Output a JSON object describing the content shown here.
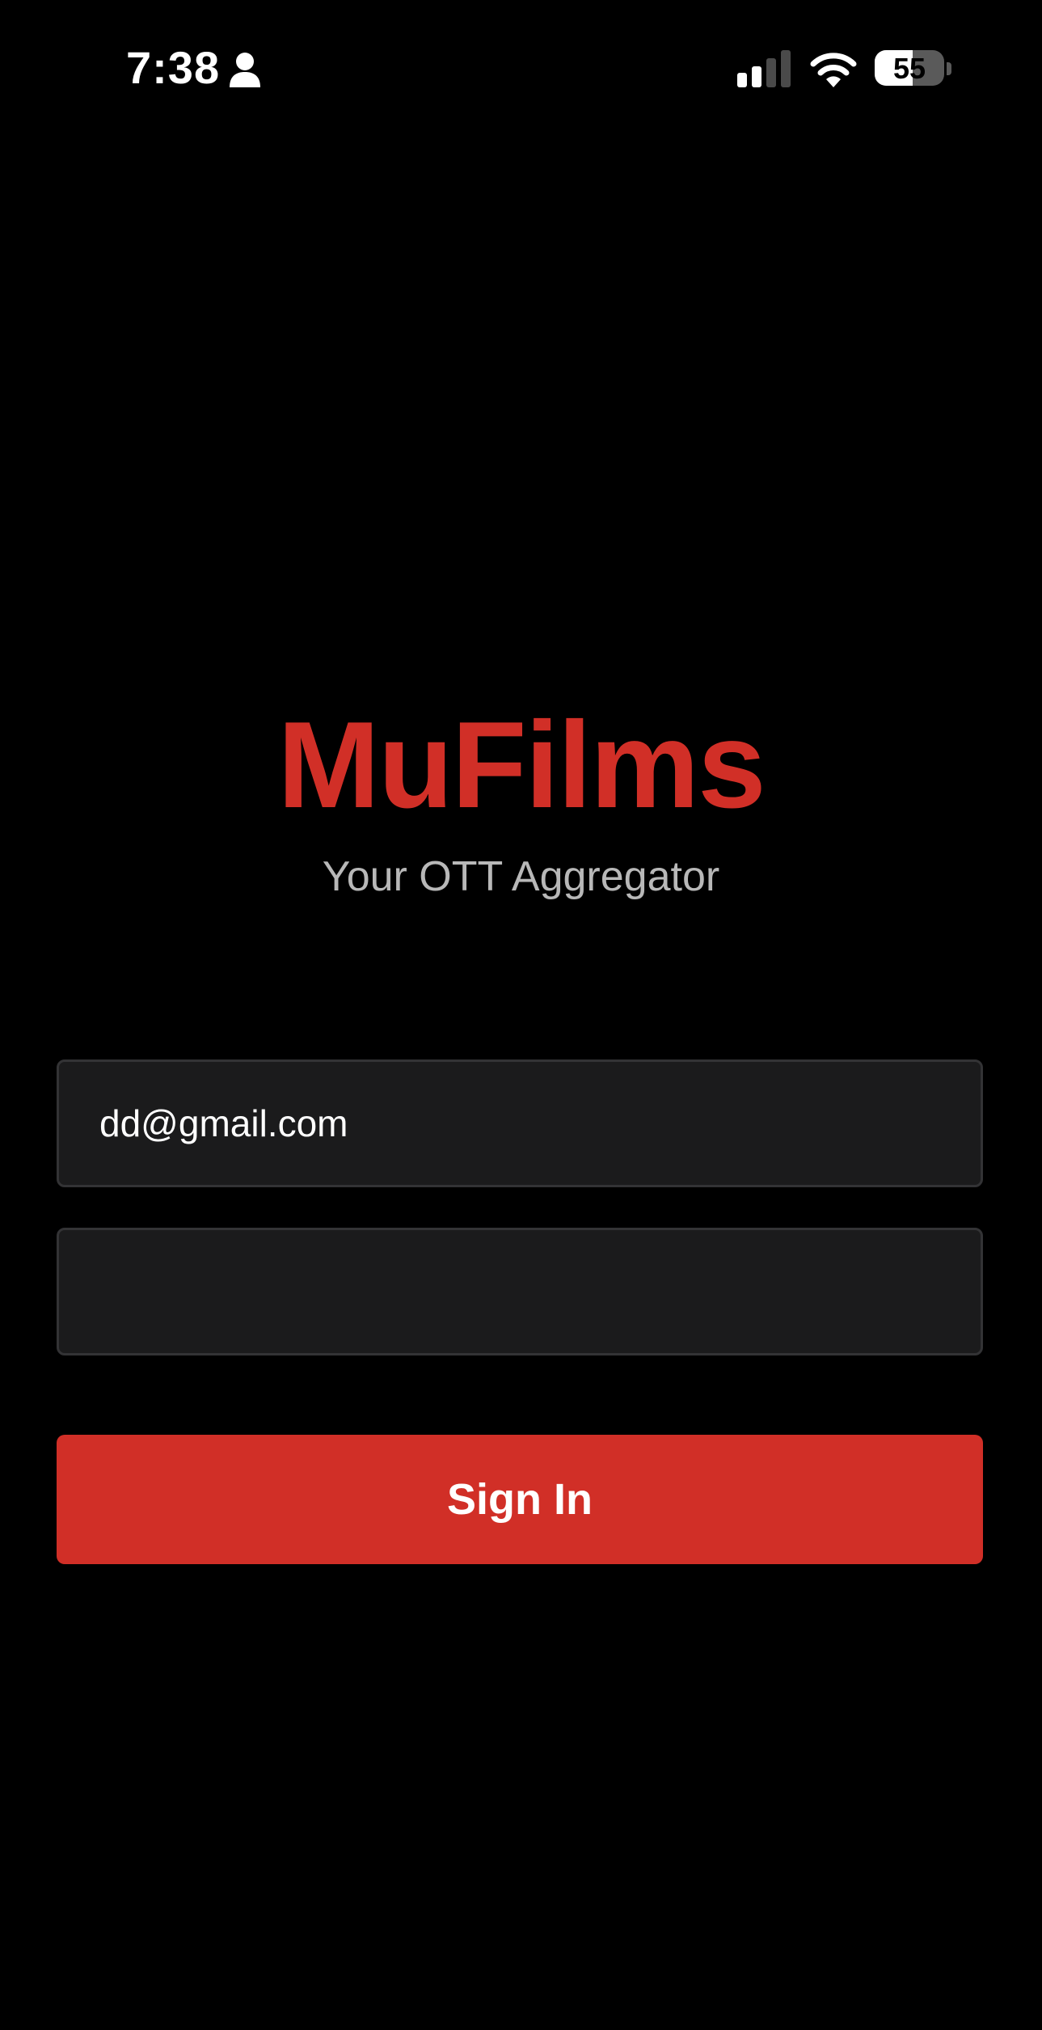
{
  "status_bar": {
    "time": "7:38",
    "battery_level": "55",
    "battery_fraction": 0.55,
    "icons": [
      "person-icon",
      "cellular-signal-icon",
      "wifi-icon",
      "battery-icon"
    ]
  },
  "brand": {
    "title": "MuFilms",
    "subtitle": "Your OTT Aggregator",
    "accent_color": "#d12f27"
  },
  "form": {
    "email_value": "dd@gmail.com",
    "password_value": "",
    "sign_in_label": "Sign In"
  },
  "colors": {
    "background": "#000000",
    "field_background": "#1b1b1c",
    "field_border": "#333335",
    "subtitle_text": "#b8b8b8"
  }
}
